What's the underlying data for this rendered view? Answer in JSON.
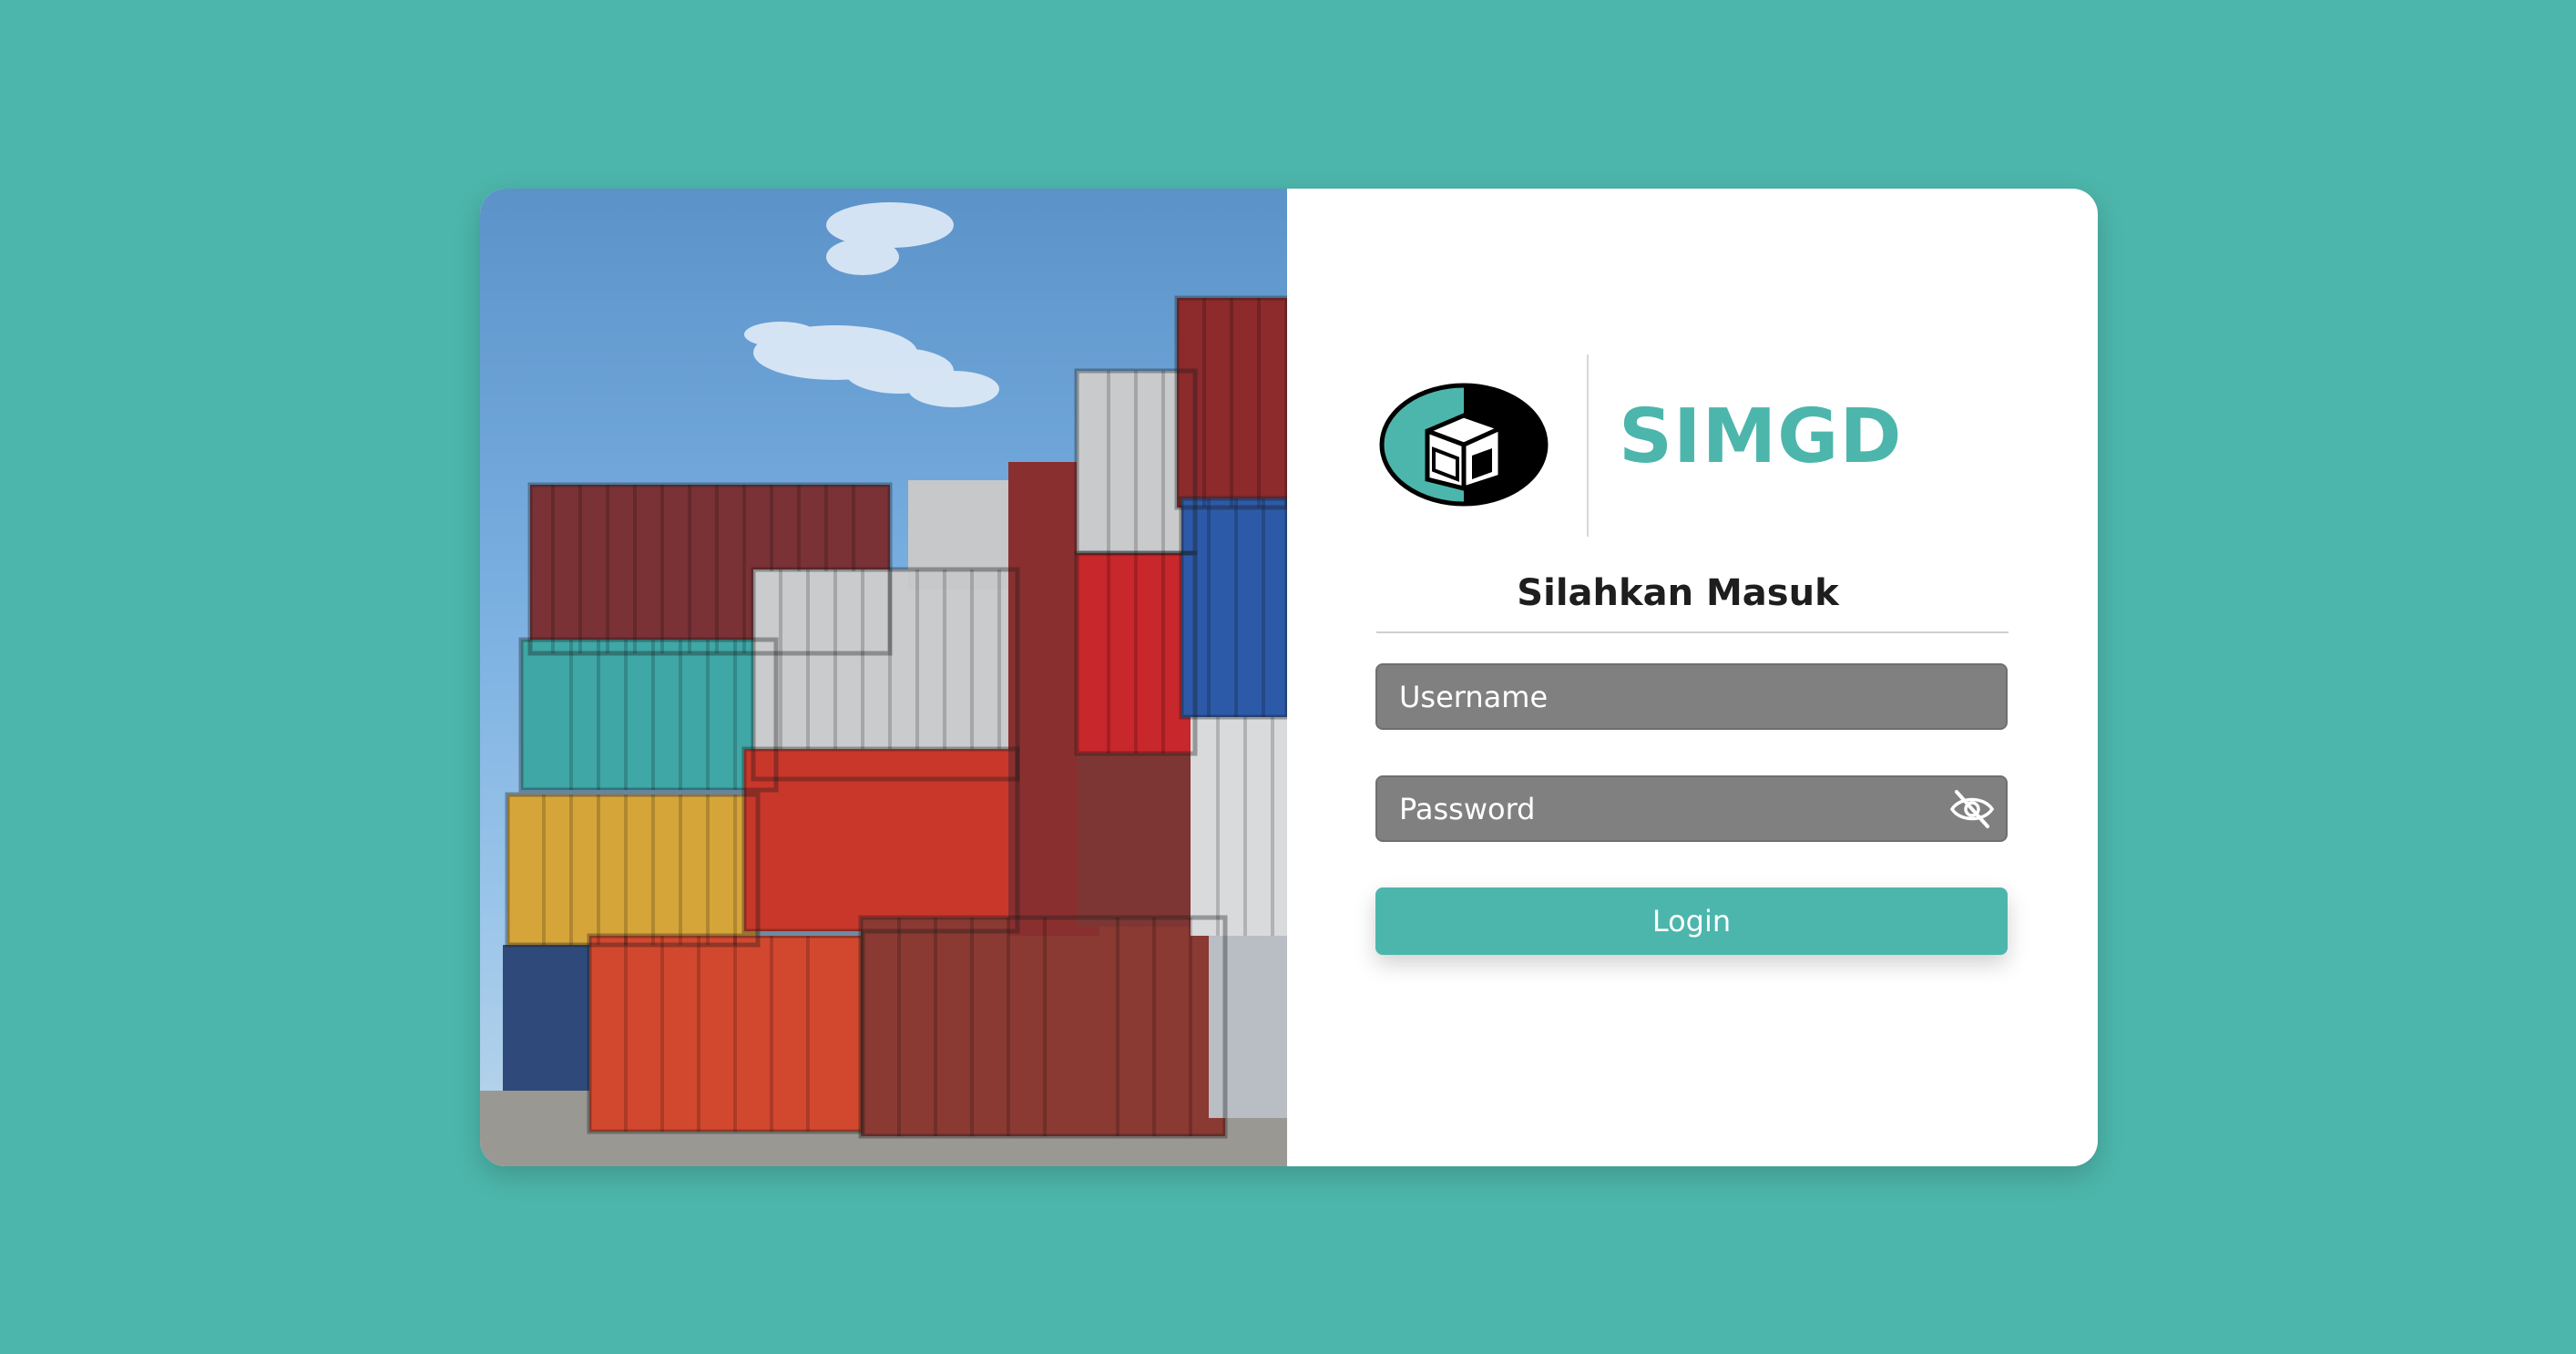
{
  "brand": {
    "name": "SIMGD",
    "accent_color": "#4db6ac",
    "logo_icon": "container-logo-icon"
  },
  "login": {
    "subtitle": "Silahkan Masuk",
    "username_placeholder": "Username",
    "password_placeholder": "Password",
    "toggle_icon": "eye-slash-icon",
    "button_label": "Login"
  },
  "hero": {
    "image": "shipping-containers-photo"
  }
}
